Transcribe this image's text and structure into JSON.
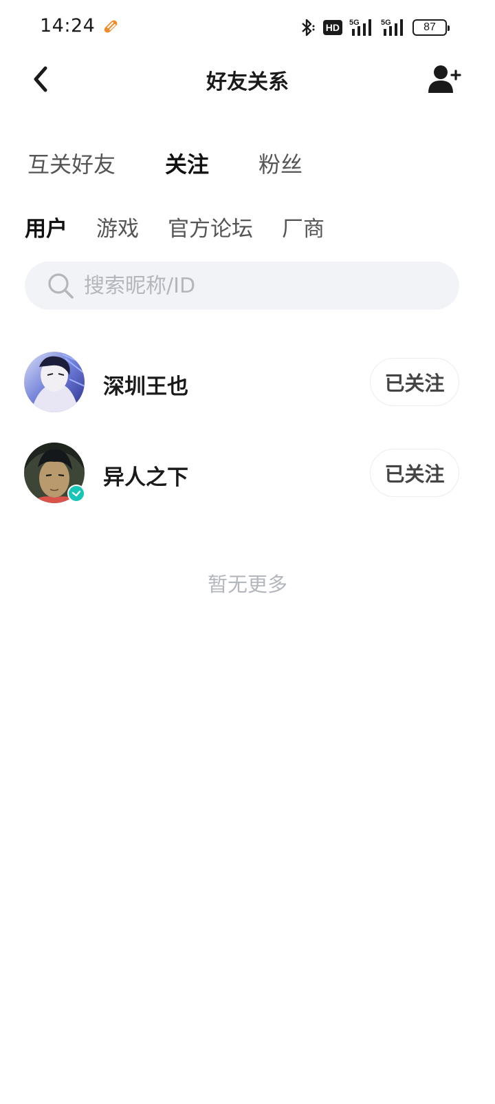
{
  "status_bar": {
    "time": "14:24",
    "hd_label": "HD",
    "network_1": "5G",
    "network_2": "5G",
    "battery_level": "87"
  },
  "header": {
    "title": "好友关系"
  },
  "main_tabs": [
    {
      "label": "互关好友",
      "active": false
    },
    {
      "label": "关注",
      "active": true
    },
    {
      "label": "粉丝",
      "active": false
    }
  ],
  "sub_tabs": [
    {
      "label": "用户",
      "active": true
    },
    {
      "label": "游戏",
      "active": false
    },
    {
      "label": "官方论坛",
      "active": false
    },
    {
      "label": "厂商",
      "active": false
    }
  ],
  "search": {
    "placeholder": "搜索昵称/ID",
    "value": ""
  },
  "users": [
    {
      "name": "深圳王也",
      "follow_label": "已关注",
      "verified": false
    },
    {
      "name": "异人之下",
      "follow_label": "已关注",
      "verified": true
    }
  ],
  "footer_text": "暂无更多",
  "colors": {
    "accent": "#17c6b7",
    "notification_icon": "#f28a26"
  },
  "icons": [
    "back-arrow-icon",
    "add-user-icon",
    "search-icon",
    "bluetooth-icon",
    "signal-icon",
    "battery-icon",
    "verified-icon"
  ]
}
